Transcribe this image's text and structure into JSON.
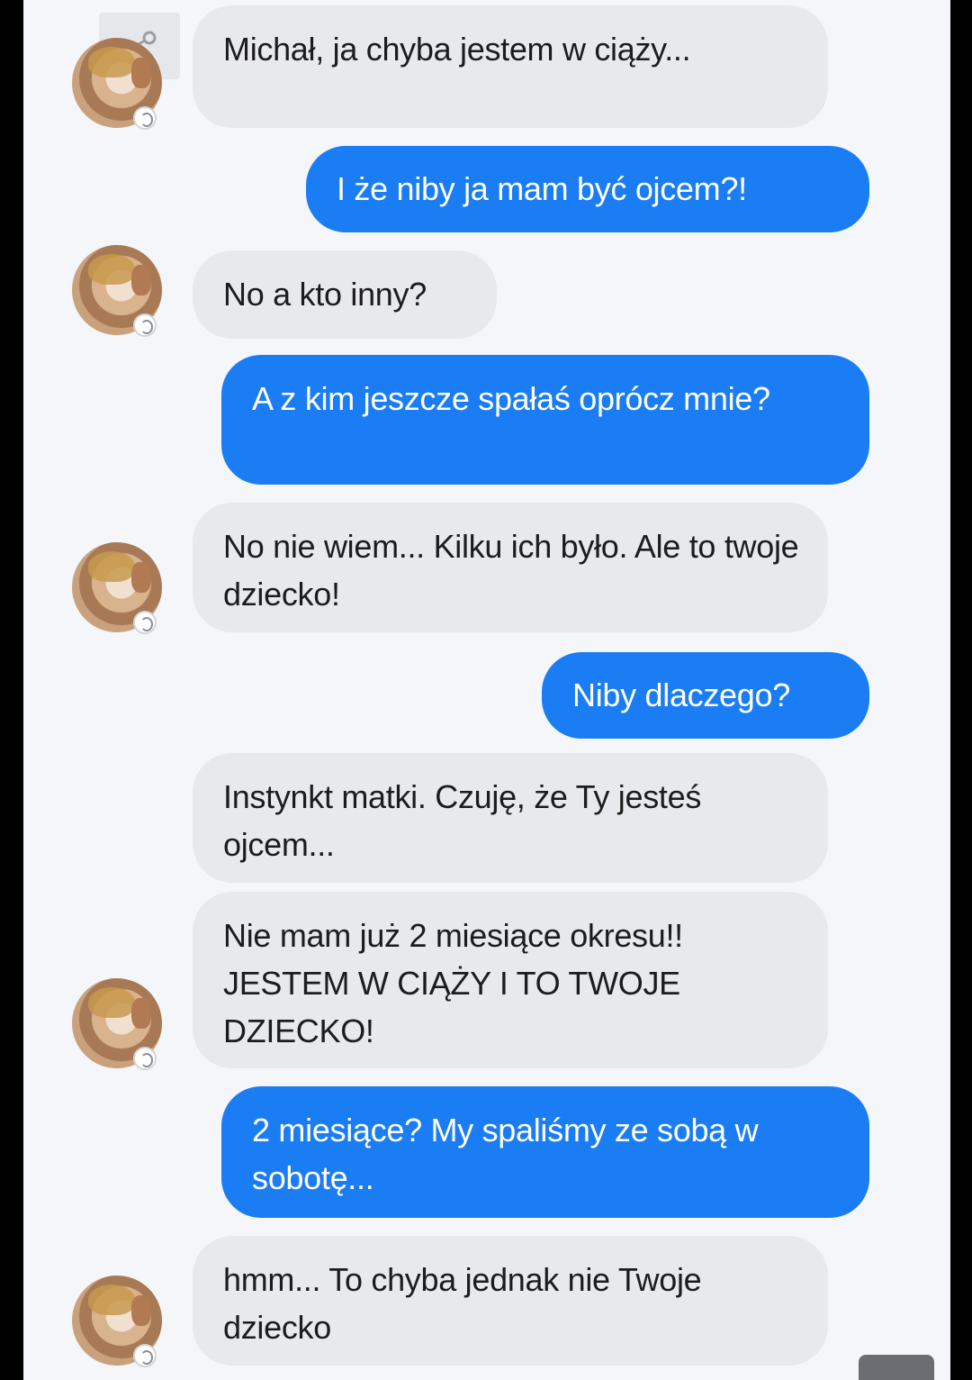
{
  "conversation": {
    "messages": [
      {
        "side": "in",
        "text": "Michał, ja chyba jestem w ciąży..."
      },
      {
        "side": "out",
        "text": "I że niby ja mam być ojcem?!"
      },
      {
        "side": "in",
        "text": "No a kto inny?"
      },
      {
        "side": "out",
        "text": "A z kim jeszcze spałaś oprócz mnie?"
      },
      {
        "side": "in",
        "text": "No nie wiem... Kilku ich było. Ale to twoje dziecko!"
      },
      {
        "side": "out",
        "text": "Niby dlaczego?"
      },
      {
        "side": "in",
        "text": "Instynkt matki. Czuję, że Ty jesteś ojcem..."
      },
      {
        "side": "in",
        "text": "Nie mam już 2 miesiące okresu!! JESTEM W CIĄŻY I TO TWOJE DZIECKO!"
      },
      {
        "side": "out",
        "text": "2 miesiące? My spaliśmy ze sobą w sobotę..."
      },
      {
        "side": "in",
        "text": "hmm... To chyba jednak nie Twoje dziecko"
      }
    ]
  },
  "icons": {
    "share": "share-icon",
    "avatar": "contact-avatar",
    "badge": "messenger-badge-icon"
  },
  "colors": {
    "incoming_bubble": "#e8e9ed",
    "outgoing_bubble": "#1b7df3",
    "background": "#f4f6f9"
  }
}
